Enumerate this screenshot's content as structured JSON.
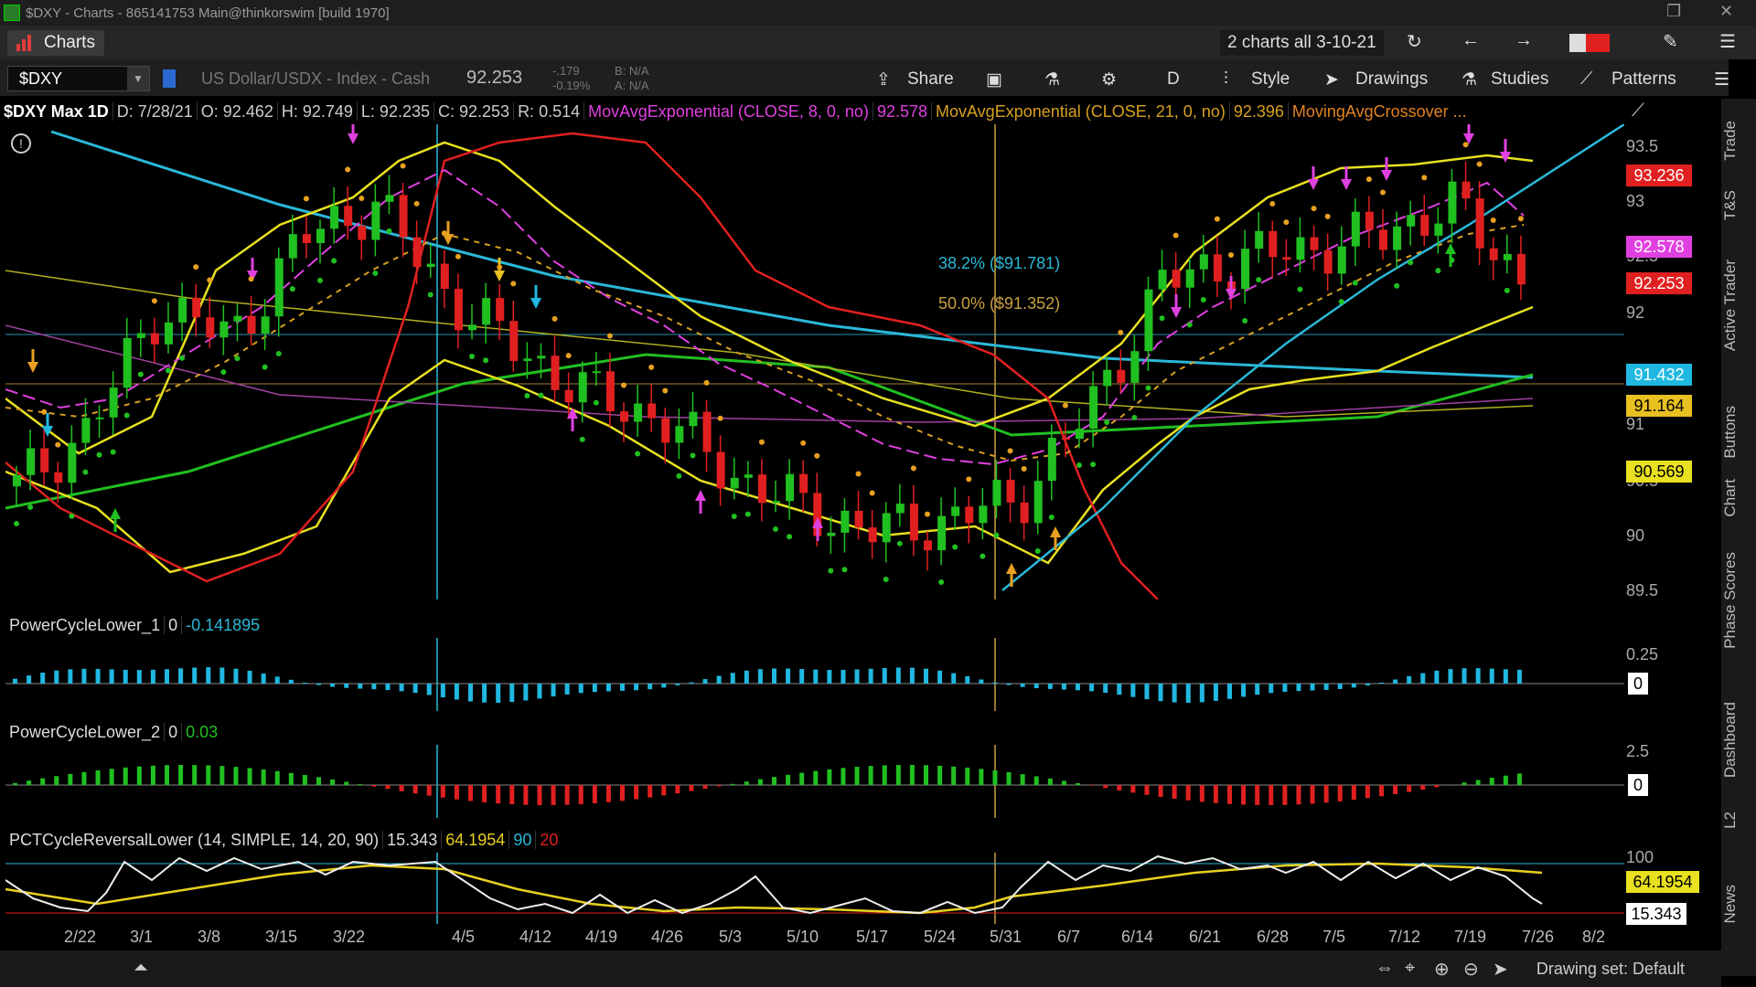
{
  "window": {
    "title": "$DXY - Charts - 865141753 Main@thinkorswim [build 1970]"
  },
  "toolbar1": {
    "charts_label": "Charts",
    "grid_name": "2 charts all 3-10-21"
  },
  "toolbar2": {
    "symbol": "$DXY",
    "description": "US Dollar/USDX - Index - Cash",
    "last": "92.253",
    "change": "-.179",
    "change_pct": "-0.19%",
    "bid": "B: N/A",
    "ask": "A: N/A",
    "share": "Share",
    "period": "D",
    "style": "Style",
    "drawings": "Drawings",
    "studies": "Studies",
    "patterns": "Patterns"
  },
  "info": {
    "symbol": "$DXY Max 1D",
    "date": "D: 7/28/21",
    "open": "O: 92.462",
    "high": "H: 92.749",
    "low": "L: 92.235",
    "close": "C: 92.253",
    "range": "R: 0.514",
    "ema8": "MovAvgExponential (CLOSE, 8, 0, no)",
    "ema8_val": "92.578",
    "ema21": "MovAvgExponential (CLOSE, 21, 0, no)",
    "ema21_val": "92.396",
    "crossover": "MovingAvgCrossover ..."
  },
  "price_axis": [
    "93.5",
    "93",
    "92.5",
    "92",
    "91",
    "90.5",
    "90",
    "89.5"
  ],
  "price_tags": [
    {
      "value": "93.236",
      "color": "#e02020"
    },
    {
      "value": "92.578",
      "color": "#e040e0"
    },
    {
      "value": "92.253",
      "color": "#e02020"
    },
    {
      "value": "91.432",
      "color": "#20b8e0"
    },
    {
      "value": "91.164",
      "color": "#e8c020"
    },
    {
      "value": "90.569",
      "color": "#e8e020"
    }
  ],
  "fib": {
    "f382": "38.2% ($91.781)",
    "f50": "50.0% ($91.352)"
  },
  "panels": {
    "p1": {
      "name": "PowerCycleLower_1",
      "zero": "0",
      "value": "-0.141895",
      "axis_top": "0.25",
      "axis_zero": "0"
    },
    "p2": {
      "name": "PowerCycleLower_2",
      "zero": "0",
      "value": "0.03",
      "axis_top": "2.5",
      "axis_zero": "0"
    },
    "p3": {
      "name": "PCTCycleReversalLower (14, SIMPLE, 14, 20, 90)",
      "v1": "15.343",
      "v2": "64.1954",
      "v3": "90",
      "v4": "20",
      "axis_top": "100",
      "tag1": "64.1954",
      "tag2": "15.343"
    }
  },
  "x_axis": [
    "2/22",
    "3/1",
    "3/8",
    "3/15",
    "3/22",
    "4/5",
    "4/12",
    "4/19",
    "4/26",
    "5/3",
    "5/10",
    "5/17",
    "5/24",
    "5/31",
    "6/7",
    "6/14",
    "6/21",
    "6/28",
    "7/5",
    "7/12",
    "7/19",
    "7/26",
    "8/2"
  ],
  "right_tabs": [
    "Trade",
    "T&S",
    "Active Trader",
    "Buttons",
    "Chart",
    "Phase Scores",
    "Dashboard",
    "L2",
    "News"
  ],
  "bottom": {
    "drawing_set": "Drawing set: Default"
  },
  "chart_data": {
    "type": "candlestick",
    "title": "$DXY Max 1D",
    "x": [
      "2/22",
      "3/1",
      "3/8",
      "3/15",
      "3/22",
      "4/5",
      "4/12",
      "4/19",
      "4/26",
      "5/3",
      "5/10",
      "5/17",
      "5/24",
      "5/31",
      "6/7",
      "6/14",
      "6/21",
      "6/28",
      "7/5",
      "7/12",
      "7/19",
      "7/26"
    ],
    "close": [
      90.4,
      90.9,
      92.0,
      91.7,
      92.6,
      92.9,
      92.1,
      91.6,
      91.2,
      91.0,
      90.5,
      90.2,
      90.0,
      90.1,
      90.3,
      91.1,
      92.2,
      92.4,
      92.5,
      92.6,
      92.9,
      92.25
    ],
    "ylim": [
      89.4,
      93.6
    ]
  }
}
